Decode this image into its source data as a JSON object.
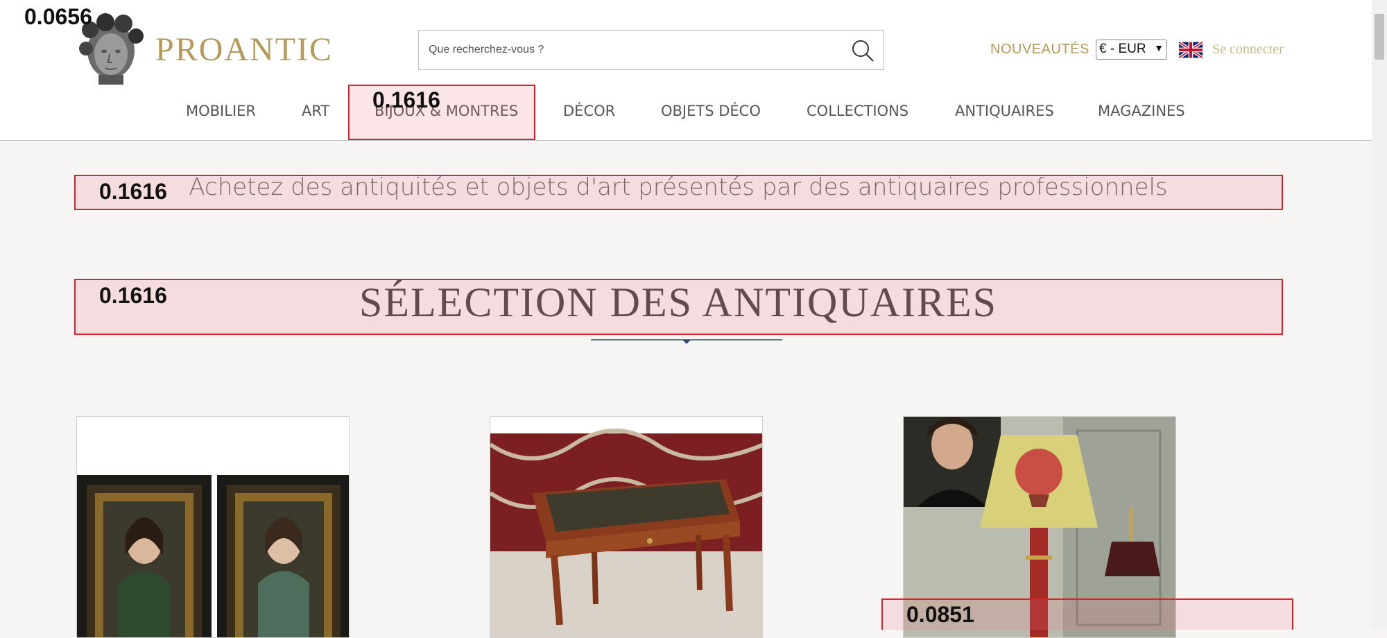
{
  "header": {
    "logo_text": "PROANTIC",
    "search": {
      "placeholder": "Que recherchez-vous ?",
      "value": ""
    },
    "nouveautes": "NOUVEAUTÉS",
    "currency": {
      "selected": "€ - EUR"
    },
    "login": "Se connecter",
    "colors": {
      "brand_gold": "#b59a5a",
      "login_gold": "#c9b98b"
    }
  },
  "nav": {
    "items": [
      {
        "label": "MOBILIER"
      },
      {
        "label": "ART"
      },
      {
        "label": "BIJOUX & MONTRES"
      },
      {
        "label": "DÉCOR"
      },
      {
        "label": "OBJETS DÉCO"
      },
      {
        "label": "COLLECTIONS"
      },
      {
        "label": "ANTIQUAIRES"
      },
      {
        "label": "MAGAZINES"
      }
    ]
  },
  "main": {
    "tagline": "Achetez des antiquités et objets d'art présentés par des antiquaires professionnels",
    "section_title": "SÉLECTION DES ANTIQUAIRES",
    "cards": [
      {
        "name": "portraits-pair-image"
      },
      {
        "name": "writing-desk-image"
      },
      {
        "name": "balloon-lamp-image"
      }
    ]
  },
  "overlays": {
    "top_left_label": "0.0656",
    "nav_label": "0.1616",
    "tagline_label": "0.1616",
    "title_label": "0.1616",
    "card_label": "0.0851"
  }
}
